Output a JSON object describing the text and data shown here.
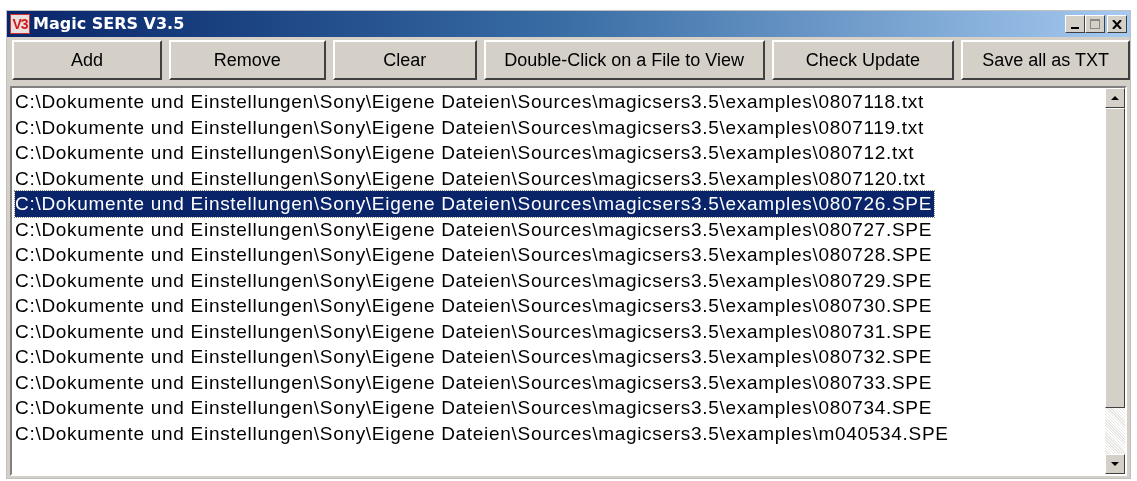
{
  "window": {
    "title": "Magic SERS V3.5",
    "logo": "V3"
  },
  "toolbar": [
    "Add",
    "Remove",
    "Clear",
    "Double-Click on a File to View",
    "Check Update",
    "Save all as TXT"
  ],
  "files": [
    {
      "path": "C:\\Dokumente und Einstellungen\\Sony\\Eigene Dateien\\Sources\\magicsers3.5\\examples\\0807118.txt",
      "selected": false
    },
    {
      "path": "C:\\Dokumente und Einstellungen\\Sony\\Eigene Dateien\\Sources\\magicsers3.5\\examples\\0807119.txt",
      "selected": false
    },
    {
      "path": "C:\\Dokumente und Einstellungen\\Sony\\Eigene Dateien\\Sources\\magicsers3.5\\examples\\080712.txt",
      "selected": false
    },
    {
      "path": "C:\\Dokumente und Einstellungen\\Sony\\Eigene Dateien\\Sources\\magicsers3.5\\examples\\0807120.txt",
      "selected": false
    },
    {
      "path": "C:\\Dokumente und Einstellungen\\Sony\\Eigene Dateien\\Sources\\magicsers3.5\\examples\\080726.SPE",
      "selected": true
    },
    {
      "path": "C:\\Dokumente und Einstellungen\\Sony\\Eigene Dateien\\Sources\\magicsers3.5\\examples\\080727.SPE",
      "selected": false
    },
    {
      "path": "C:\\Dokumente und Einstellungen\\Sony\\Eigene Dateien\\Sources\\magicsers3.5\\examples\\080728.SPE",
      "selected": false
    },
    {
      "path": "C:\\Dokumente und Einstellungen\\Sony\\Eigene Dateien\\Sources\\magicsers3.5\\examples\\080729.SPE",
      "selected": false
    },
    {
      "path": "C:\\Dokumente und Einstellungen\\Sony\\Eigene Dateien\\Sources\\magicsers3.5\\examples\\080730.SPE",
      "selected": false
    },
    {
      "path": "C:\\Dokumente und Einstellungen\\Sony\\Eigene Dateien\\Sources\\magicsers3.5\\examples\\080731.SPE",
      "selected": false
    },
    {
      "path": "C:\\Dokumente und Einstellungen\\Sony\\Eigene Dateien\\Sources\\magicsers3.5\\examples\\080732.SPE",
      "selected": false
    },
    {
      "path": "C:\\Dokumente und Einstellungen\\Sony\\Eigene Dateien\\Sources\\magicsers3.5\\examples\\080733.SPE",
      "selected": false
    },
    {
      "path": "C:\\Dokumente und Einstellungen\\Sony\\Eigene Dateien\\Sources\\magicsers3.5\\examples\\080734.SPE",
      "selected": false
    },
    {
      "path": "C:\\Dokumente und Einstellungen\\Sony\\Eigene Dateien\\Sources\\magicsers3.5\\examples\\m040534.SPE",
      "selected": false
    }
  ]
}
